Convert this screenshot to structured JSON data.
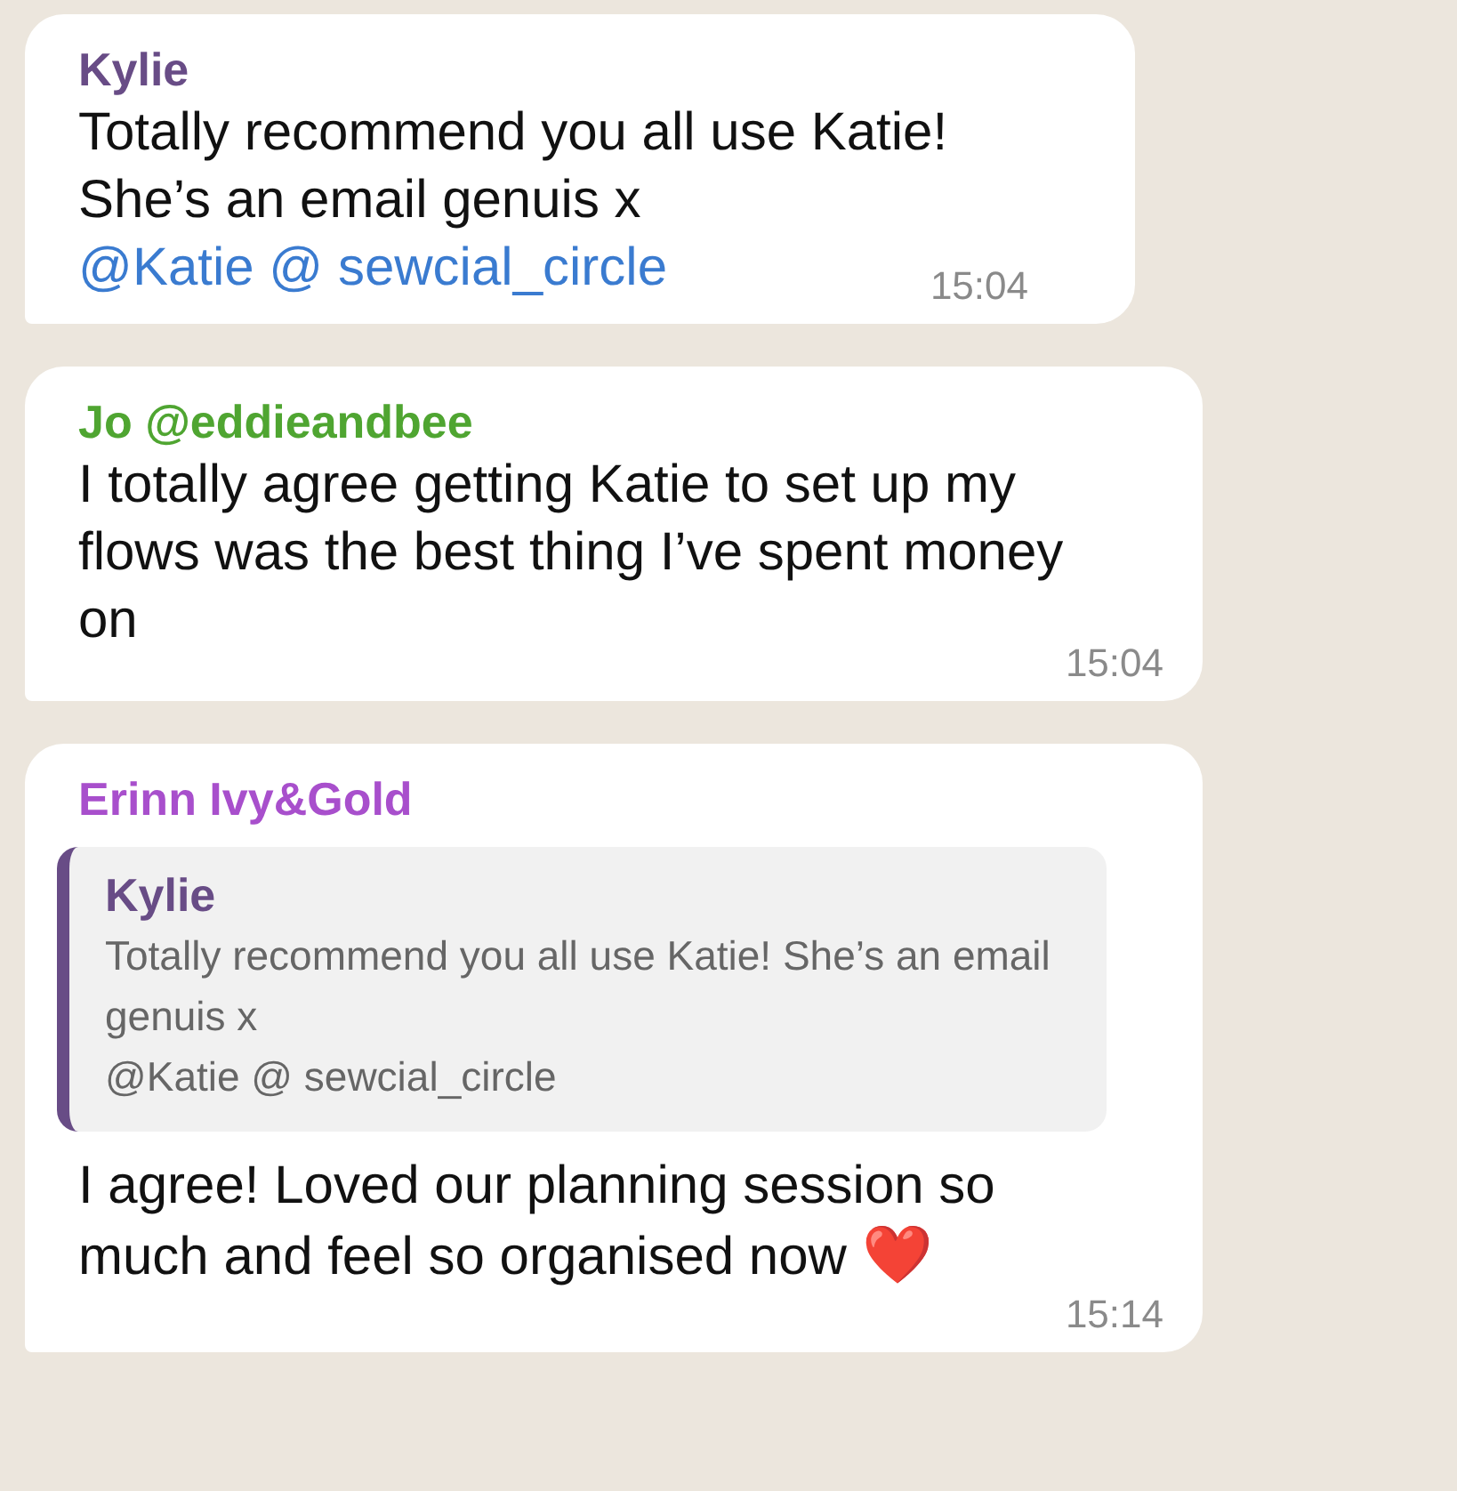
{
  "messages": [
    {
      "sender": "Kylie",
      "color": "#684c86",
      "text": "Totally recommend you all use Katie! She’s an email genuis x",
      "mentions": "@Katie @ sewcial_circle",
      "time": "15:04"
    },
    {
      "sender": "Jo @eddieandbee",
      "color": "#4fa531",
      "text": "I totally agree getting Katie to set up my flows was the best thing I’ve spent money on",
      "time": "15:04"
    },
    {
      "sender": "Erinn Ivy&Gold",
      "color": "#a84fcc",
      "quote": {
        "sender": "Kylie",
        "color": "#684c86",
        "text": "Totally recommend you all use Katie! She’s an email genuis x",
        "mentions": "@Katie @ sewcial_circle"
      },
      "text": "I agree! Loved our planning session so much and feel so organised now",
      "emoji": "❤️",
      "time": "15:14"
    }
  ]
}
